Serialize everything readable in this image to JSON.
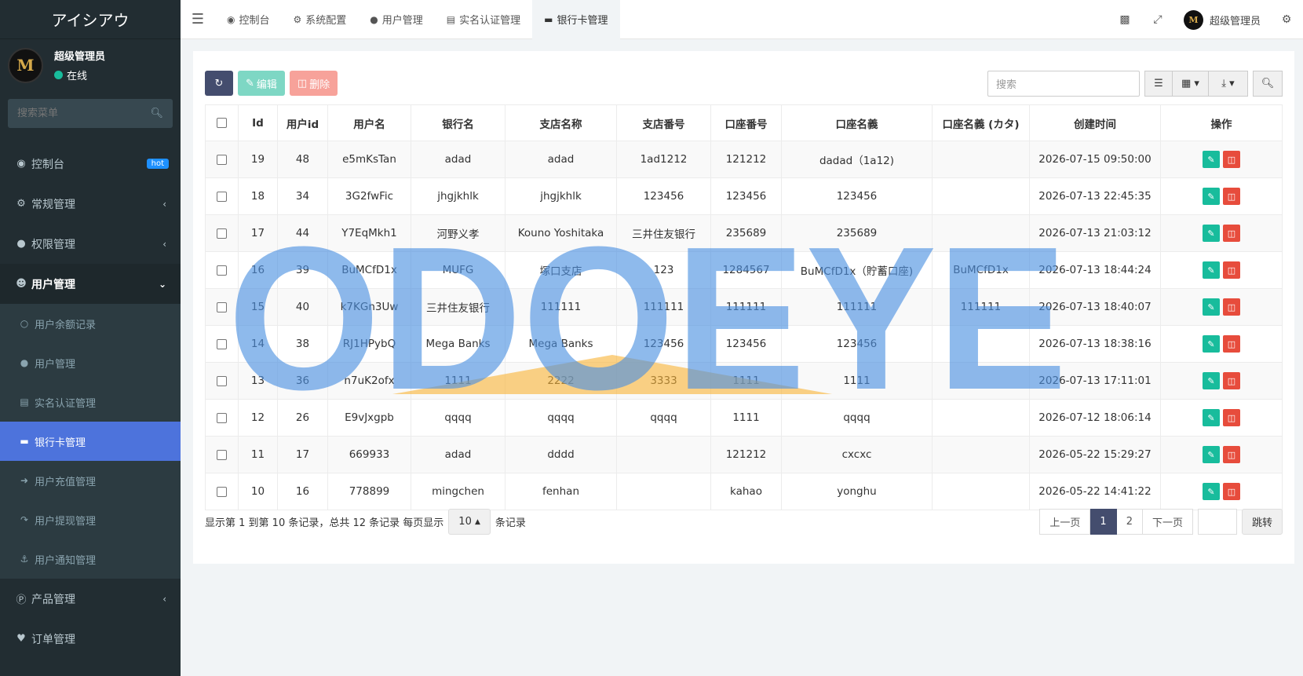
{
  "app": {
    "logo": "アイシアウ"
  },
  "sidebar": {
    "user_name": "超级管理员",
    "user_status": "在线",
    "avatar_text": "M",
    "search_placeholder": "搜索菜单",
    "items": [
      {
        "label": "控制台",
        "badge": "hot"
      },
      {
        "label": "常规管理"
      },
      {
        "label": "权限管理"
      },
      {
        "label": "用户管理"
      }
    ],
    "sub_items": [
      {
        "label": "用户余额记录"
      },
      {
        "label": "用户管理"
      },
      {
        "label": "实名认证管理"
      },
      {
        "label": "银行卡管理"
      },
      {
        "label": "用户充值管理"
      },
      {
        "label": "用户提现管理"
      },
      {
        "label": "用户通知管理"
      }
    ],
    "bottom_items": [
      {
        "label": "产品管理"
      },
      {
        "label": "订单管理"
      }
    ]
  },
  "header": {
    "tabs": [
      {
        "label": "控制台"
      },
      {
        "label": "系统配置"
      },
      {
        "label": "用户管理"
      },
      {
        "label": "实名认证管理"
      },
      {
        "label": "银行卡管理"
      }
    ],
    "user_name": "超级管理员",
    "avatar_text": "M"
  },
  "toolbar": {
    "edit_label": "编辑",
    "delete_label": "删除",
    "search_placeholder": "搜索"
  },
  "table": {
    "columns": [
      "Id",
      "用户id",
      "用户名",
      "银行名",
      "支店名称",
      "支店番号",
      "口座番号",
      "口座名義",
      "口座名義 (カタ)",
      "创建时间",
      "操作"
    ],
    "rows": [
      {
        "id": "19",
        "uid": "48",
        "username": "e5mKsTan",
        "bank": "adad",
        "branch": "adad",
        "branch_no": "1ad1212",
        "account_no": "121212",
        "account_name": "dadad（1a12)",
        "account_kana": "",
        "created": "2026-07-15 09:50:00"
      },
      {
        "id": "18",
        "uid": "34",
        "username": "3G2fwFic",
        "bank": "jhgjkhlk",
        "branch": "jhgjkhlk",
        "branch_no": "123456",
        "account_no": "123456",
        "account_name": "123456",
        "account_kana": "",
        "created": "2026-07-13 22:45:35"
      },
      {
        "id": "17",
        "uid": "44",
        "username": "Y7EqMkh1",
        "bank": "河野义孝",
        "branch": "Kouno Yoshitaka",
        "branch_no": "三井住友银行",
        "account_no": "235689",
        "account_name": "235689",
        "account_kana": "",
        "created": "2026-07-13 21:03:12"
      },
      {
        "id": "16",
        "uid": "39",
        "username": "BuMCfD1x",
        "bank": "MUFG",
        "branch": "塚口支店",
        "branch_no": "123",
        "account_no": "1284567",
        "account_name": "BuMCfD1x（貯蓄口座)",
        "account_kana": "BuMCfD1x",
        "created": "2026-07-13 18:44:24"
      },
      {
        "id": "15",
        "uid": "40",
        "username": "k7KGn3Uw",
        "bank": "三井住友银行",
        "branch": "111111",
        "branch_no": "111111",
        "account_no": "111111",
        "account_name": "111111",
        "account_kana": "111111",
        "created": "2026-07-13 18:40:07"
      },
      {
        "id": "14",
        "uid": "38",
        "username": "RJ1HPybQ",
        "bank": "Mega Banks",
        "branch": "Mega Banks",
        "branch_no": "123456",
        "account_no": "123456",
        "account_name": "123456",
        "account_kana": "",
        "created": "2026-07-13 18:38:16"
      },
      {
        "id": "13",
        "uid": "36",
        "username": "n7uK2ofx",
        "bank": "1111",
        "branch": "2222",
        "branch_no": "3333",
        "account_no": "1111",
        "account_name": "1111",
        "account_kana": "",
        "created": "2026-07-13 17:11:01"
      },
      {
        "id": "12",
        "uid": "26",
        "username": "E9vJxgpb",
        "bank": "qqqq",
        "branch": "qqqq",
        "branch_no": "qqqq",
        "account_no": "1111",
        "account_name": "qqqq",
        "account_kana": "",
        "created": "2026-07-12 18:06:14"
      },
      {
        "id": "11",
        "uid": "17",
        "username": "669933",
        "bank": "adad",
        "branch": "dddd",
        "branch_no": "",
        "account_no": "121212",
        "account_name": "cxcxc",
        "account_kana": "",
        "created": "2026-05-22 15:29:27"
      },
      {
        "id": "10",
        "uid": "16",
        "username": "778899",
        "bank": "mingchen",
        "branch": "fenhan",
        "branch_no": "",
        "account_no": "kahao",
        "account_name": "yonghu",
        "account_kana": "",
        "created": "2026-05-22 14:41:22"
      }
    ]
  },
  "pagination": {
    "info_prefix": "显示第 1 到第 10 条记录，总共 12 条记录 每页显示",
    "page_size": "10",
    "info_suffix": "条记录",
    "prev": "上一页",
    "pages": [
      "1",
      "2"
    ],
    "next": "下一页",
    "go": "跳转"
  },
  "watermark": {
    "text": "ODOEYE"
  },
  "colors": {
    "accent": "#4d73dc",
    "sidebar": "#222d32",
    "edit": "#18bc9c",
    "delete": "#e74c3c",
    "primary_btn": "#444d6e"
  }
}
